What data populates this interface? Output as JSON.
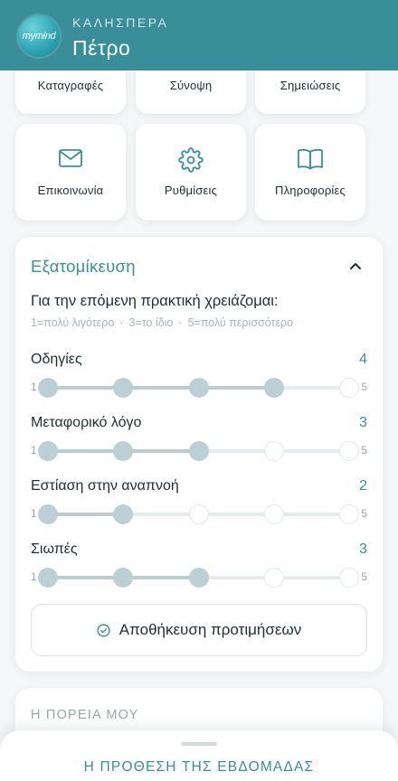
{
  "header": {
    "logo_text": "mymind",
    "greeting": "ΚΑΛΗΣΠΕΡΑ",
    "username": "Πέτρο",
    "background_color": "#3a8e9a"
  },
  "tiles_row1": [
    {
      "label": "Καταγραφές"
    },
    {
      "label": "Σύνοψη"
    },
    {
      "label": "Σημειώσεις"
    }
  ],
  "tiles_row2": [
    {
      "label": "Επικοινωνία",
      "icon": "mail-icon"
    },
    {
      "label": "Ρυθμίσεις",
      "icon": "gear-icon"
    },
    {
      "label": "Πληροφορίες",
      "icon": "book-icon"
    }
  ],
  "personalization": {
    "title": "Εξατομίκευση",
    "question": "Για την επόμενη πρακτική χρειάζομαι:",
    "hint_1": "1=πολύ λιγότερο",
    "hint_sep": "·",
    "hint_3": "3=το ίδιο",
    "hint_5": "5=πολύ περισσότερο",
    "scale_min": "1",
    "scale_max": "5",
    "preferences": [
      {
        "label": "Οδηγίες",
        "value": "4"
      },
      {
        "label": "Μεταφορικό λόγο",
        "value": "3"
      },
      {
        "label": "Εστίαση στην αναπνοή",
        "value": "2"
      },
      {
        "label": "Σιωπές",
        "value": "3"
      }
    ],
    "save_label": "Αποθήκευση προτιμήσεων"
  },
  "journey": {
    "title": "Η ΠΟΡΕΙΑ ΜΟΥ"
  },
  "bottom_sheet": {
    "title": "Η ΠΡΟΘΕΣΗ ΤΗΣ ΕΒΔΟΜΑΔΑΣ"
  },
  "colors": {
    "accent": "#3a8e9a",
    "knob_active": "#bccfd4",
    "track": "#e6ebed"
  }
}
